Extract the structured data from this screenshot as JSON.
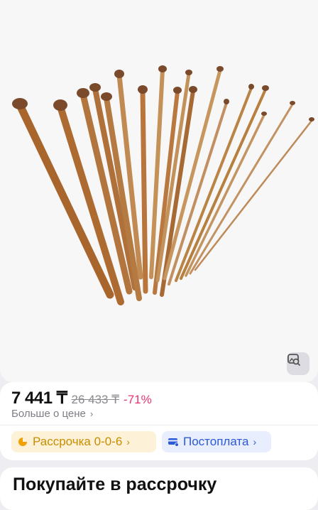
{
  "product": {
    "image_alt": "Bamboo knitting needles set",
    "image_search_icon": "image-search-icon"
  },
  "price": {
    "current": "7 441 ₸",
    "old": "26 433 ₸",
    "discount": "-71%",
    "more_link": "Больше о цене",
    "more_icon": "chevron-right-icon"
  },
  "payment_options": [
    {
      "label": "Рассрочка 0-0-6",
      "icon": "pie-chart-icon",
      "color": "#c88d00"
    },
    {
      "label": "Постоплата",
      "icon": "card-icon",
      "color": "#2b59d8"
    }
  ],
  "section": {
    "title": "Покупайте в рассрочку"
  }
}
